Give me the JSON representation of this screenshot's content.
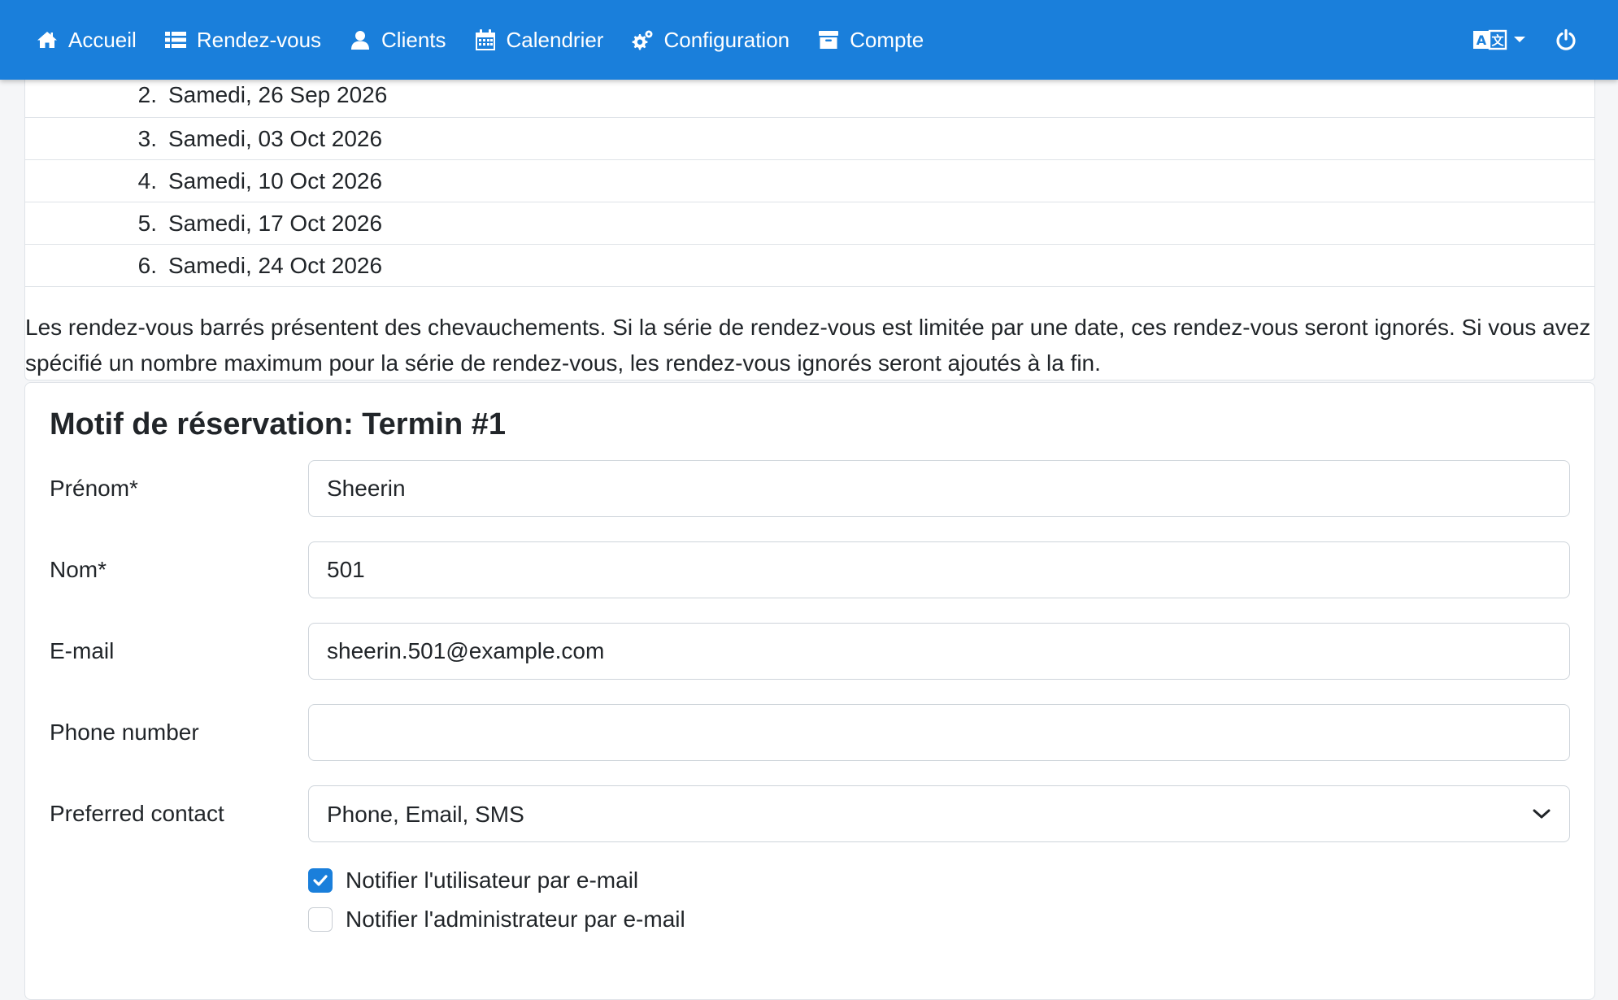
{
  "nav": {
    "items": [
      {
        "label": "Accueil",
        "icon": "home-icon"
      },
      {
        "label": "Rendez-vous",
        "icon": "list-icon"
      },
      {
        "label": "Clients",
        "icon": "user-icon"
      },
      {
        "label": "Calendrier",
        "icon": "calendar-icon"
      },
      {
        "label": "Configuration",
        "icon": "gears-icon"
      },
      {
        "label": "Compte",
        "icon": "archive-icon"
      }
    ],
    "language_icon": "translate-icon",
    "power_icon": "power-icon"
  },
  "series": {
    "rows": [
      {
        "num": "2.",
        "date": "Samedi, 26 Sep 2026"
      },
      {
        "num": "3.",
        "date": "Samedi, 03 Oct 2026"
      },
      {
        "num": "4.",
        "date": "Samedi, 10 Oct 2026"
      },
      {
        "num": "5.",
        "date": "Samedi, 17 Oct 2026"
      },
      {
        "num": "6.",
        "date": "Samedi, 24 Oct 2026"
      }
    ],
    "note": "Les rendez-vous barrés présentent des chevauchements. Si la série de rendez-vous est limitée par une date, ces rendez-vous seront ignorés. Si vous avez spécifié un nombre maximum pour la série de rendez-vous, les rendez-vous ignorés seront ajoutés à la fin."
  },
  "form": {
    "title": "Motif de réservation: Termin #1",
    "first_name": {
      "label": "Prénom*",
      "value": "Sheerin"
    },
    "last_name": {
      "label": "Nom*",
      "value": "501"
    },
    "email": {
      "label": "E-mail",
      "value": "sheerin.501@example.com"
    },
    "phone": {
      "label": "Phone number",
      "value": ""
    },
    "preferred_contact": {
      "label": "Preferred contact",
      "value": "Phone, Email, SMS"
    },
    "notify_user": {
      "label": "Notifier l'utilisateur par e-mail",
      "checked": true
    },
    "notify_admin": {
      "label": "Notifier l'administrateur par e-mail",
      "checked": false
    }
  },
  "colors": {
    "navbar": "#1a7fdb",
    "checkbox_checked": "#1a7fdb"
  }
}
